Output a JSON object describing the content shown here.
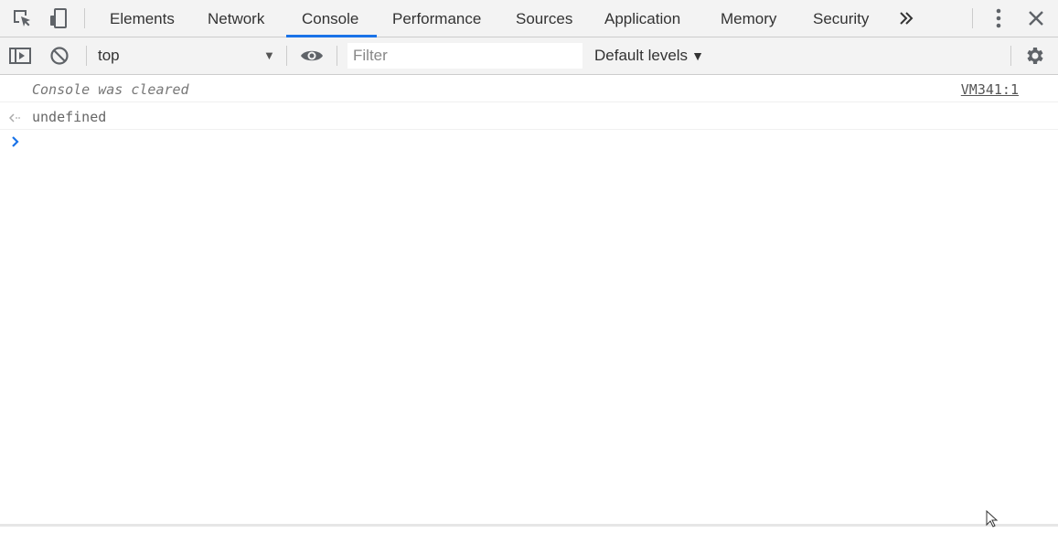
{
  "tabs": [
    {
      "label": "Elements",
      "active": false
    },
    {
      "label": "Network",
      "active": false
    },
    {
      "label": "Console",
      "active": true
    },
    {
      "label": "Performance",
      "active": false
    },
    {
      "label": "Sources",
      "active": false
    },
    {
      "label": "Application",
      "active": false
    },
    {
      "label": "Memory",
      "active": false
    },
    {
      "label": "Security",
      "active": false
    }
  ],
  "toolbar": {
    "context": "top",
    "filter_placeholder": "Filter",
    "filter_value": "",
    "levels_label": "Default levels"
  },
  "console": {
    "messages": [
      {
        "text": "Console was cleared",
        "source": "VM341:1"
      },
      {
        "text": "undefined"
      }
    ]
  },
  "icons": {
    "inspect": "inspect-element-icon",
    "device": "device-toolbar-icon",
    "more_tabs": "chevron-double-right-icon",
    "kebab": "more-vert-icon",
    "close": "close-icon",
    "sidebar": "show-sidebar-icon",
    "clear": "clear-console-icon",
    "eye": "live-expression-eye-icon",
    "settings": "gear-icon"
  },
  "colors": {
    "accent": "#1a73e8",
    "toolbar_bg": "#f3f3f3",
    "border": "#cccccc"
  }
}
